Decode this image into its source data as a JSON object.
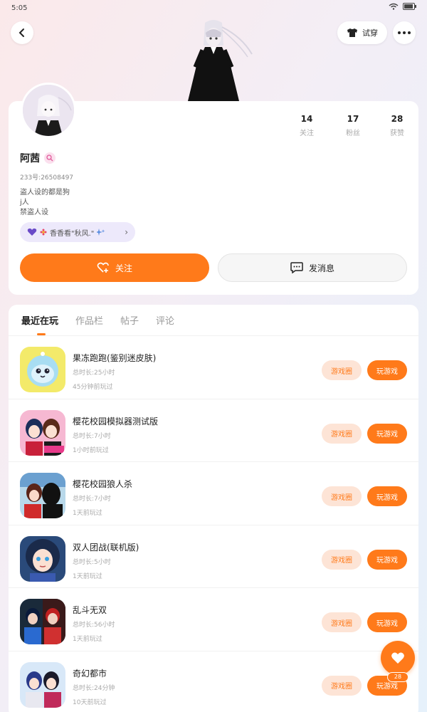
{
  "status_bar": {
    "time": "5:05"
  },
  "header": {
    "outfit_label": "试穿"
  },
  "profile": {
    "stats": [
      {
        "value": "14",
        "label": "关注"
      },
      {
        "value": "17",
        "label": "粉丝"
      },
      {
        "value": "28",
        "label": "获赞"
      }
    ],
    "username": "阿茜",
    "uid_text": "233号:26508497",
    "bio_lines": [
      "盗人设的都是狗",
      "j人",
      "禁盗人设"
    ],
    "tag_text": "香香看\"秋风.\"",
    "follow_label": "关注",
    "message_label": "发消息"
  },
  "tabs": [
    {
      "label": "最近在玩",
      "active": true
    },
    {
      "label": "作品栏",
      "active": false
    },
    {
      "label": "帖子",
      "active": false
    },
    {
      "label": "评论",
      "active": false
    }
  ],
  "game_buttons": {
    "circle_label": "游戏圈",
    "play_label": "玩游戏"
  },
  "games": [
    {
      "name": "果冻跑跑(鉴别迷皮肤)",
      "duration": "总时长:25小时",
      "last_played": "45分钟前玩过"
    },
    {
      "name": "樱花校园模拟器测试版",
      "duration": "总时长:7小时",
      "last_played": "1小时前玩过"
    },
    {
      "name": "樱花校园狼人杀",
      "duration": "总时长:7小时",
      "last_played": "1天前玩过"
    },
    {
      "name": "双人团战(联机版)",
      "duration": "总时长:5小时",
      "last_played": "1天前玩过"
    },
    {
      "name": "乱斗无双",
      "duration": "总时长:56小时",
      "last_played": "1天前玩过"
    },
    {
      "name": "奇幻都市",
      "duration": "总时长:24分钟",
      "last_played": "10天前玩过"
    }
  ],
  "fab": {
    "count": "28"
  },
  "colors": {
    "accent": "#ff7a1a",
    "accent_light": "#fde4d6"
  }
}
